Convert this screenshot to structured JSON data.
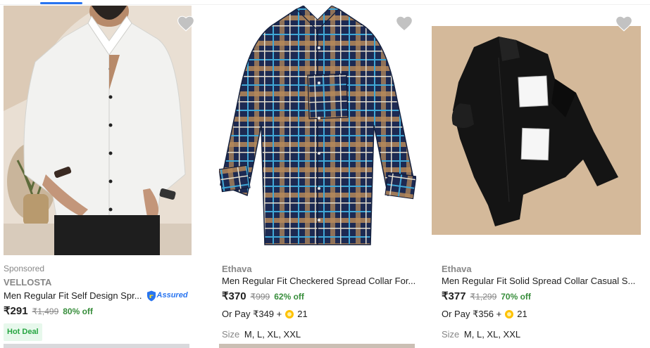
{
  "products": [
    {
      "sponsored": "Sponsored",
      "brand": "VELLOSTA",
      "title": "Men Regular Fit Self Design Spr...",
      "assured": "Assured",
      "price": "₹291",
      "mrp": "₹1,499",
      "discount": "80% off",
      "badge": "Hot Deal"
    },
    {
      "brand": "Ethava",
      "title": "Men Regular Fit Checkered Spread Collar For...",
      "price": "₹370",
      "mrp": "₹999",
      "discount": "62% off",
      "or_pay": "Or Pay ₹349 +",
      "coins": "21",
      "size_label": "Size",
      "sizes": "M, L, XL, XXL"
    },
    {
      "brand": "Ethava",
      "title": "Men Regular Fit Solid Spread Collar Casual S...",
      "price": "₹377",
      "mrp": "₹1,299",
      "discount": "70% off",
      "or_pay": "Or Pay ₹356 +",
      "coins": "21",
      "size_label": "Size",
      "sizes": "M, L, XL, XXL"
    }
  ],
  "colors": {
    "accent": "#2874f0",
    "discount": "#388e3c",
    "muted": "#878787",
    "wishlist": "#c2c2c2",
    "coin": "#ffc200"
  },
  "icons": [
    "heart-icon",
    "assured-shield-icon",
    "supercoin-icon"
  ]
}
